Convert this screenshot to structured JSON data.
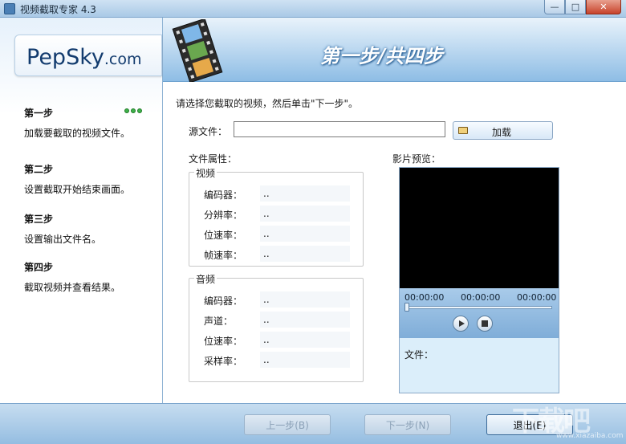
{
  "window": {
    "title": "视频截取专家 4.3",
    "minimize": "—",
    "maximize": "□",
    "close": "✕"
  },
  "logo": {
    "main": "PepSky",
    "suffix": ".com"
  },
  "header": {
    "title": "第一步/共四步"
  },
  "steps": [
    {
      "title": "第一步",
      "desc": "加载要截取的视频文件。"
    },
    {
      "title": "第二步",
      "desc": "设置截取开始结束画面。"
    },
    {
      "title": "第三步",
      "desc": "设置输出文件名。"
    },
    {
      "title": "第四步",
      "desc": "截取视频并查看结果。"
    }
  ],
  "content": {
    "instruction": "请选择您截取的视频，然后单击\"下一步\"。",
    "source_label": "源文件：",
    "source_value": "",
    "load_button": "加载",
    "file_props_label": "文件属性：",
    "video_group": {
      "title": "视频",
      "rows": [
        {
          "key": "编码器：",
          "value": ".."
        },
        {
          "key": "分辨率：",
          "value": ".."
        },
        {
          "key": "位速率：",
          "value": ".."
        },
        {
          "key": "帧速率：",
          "value": ".."
        }
      ]
    },
    "audio_group": {
      "title": "音频",
      "rows": [
        {
          "key": "编码器：",
          "value": ".."
        },
        {
          "key": "声道：",
          "value": ".."
        },
        {
          "key": "位速率：",
          "value": ".."
        },
        {
          "key": "采样率：",
          "value": ".."
        }
      ]
    },
    "preview_label": "影片预览：",
    "player": {
      "time_start": "00:00:00",
      "time_current": "00:00:00",
      "time_end": "00:00:00",
      "file_label": "文件："
    }
  },
  "footer": {
    "prev": "上一步(B)",
    "next": "下一步(N)",
    "exit": "退出(E)"
  },
  "watermark": {
    "text": "下载吧",
    "url": "www.xiazaiba.com"
  },
  "colors": {
    "accent": "#3fb14a",
    "header_title": "#ffffff",
    "footer": "#94bde1"
  }
}
